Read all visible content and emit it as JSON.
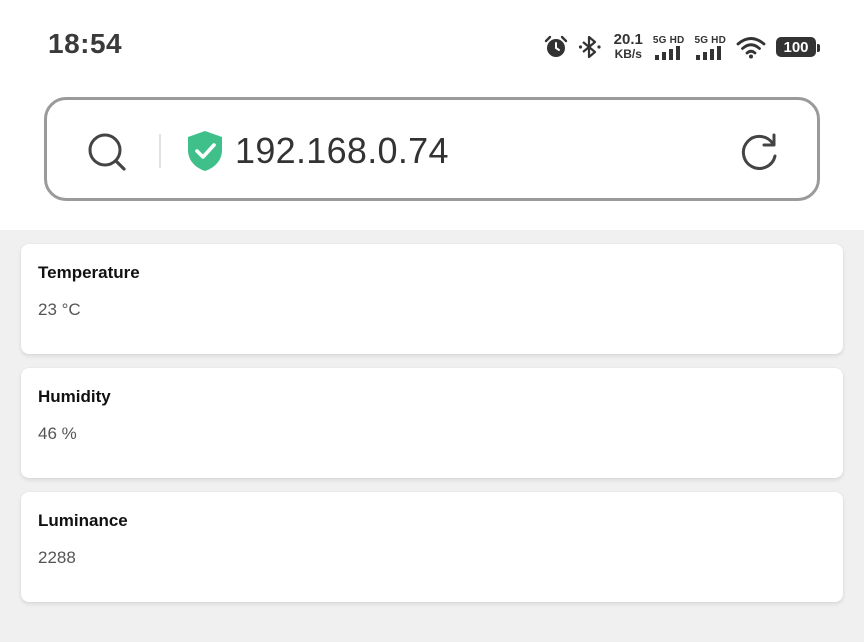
{
  "status_bar": {
    "time": "18:54",
    "net_speed_value": "20.1",
    "net_speed_unit": "KB/s",
    "sim1_label": "5G HD",
    "sim2_label": "5G HD",
    "battery": "100",
    "icons": [
      "alarm-icon",
      "bluetooth-icon",
      "signal-icon",
      "signal-icon",
      "wifi-icon",
      "battery-icon"
    ]
  },
  "address_bar": {
    "url": "192.168.0.74",
    "secure_color": "#3fbf8a",
    "icons": [
      "search-icon",
      "shield-check-icon",
      "reload-icon"
    ]
  },
  "cards": [
    {
      "title": "Temperature",
      "value": "23 °C"
    },
    {
      "title": "Humidity",
      "value": "46 %"
    },
    {
      "title": "Luminance",
      "value": "2288"
    }
  ]
}
